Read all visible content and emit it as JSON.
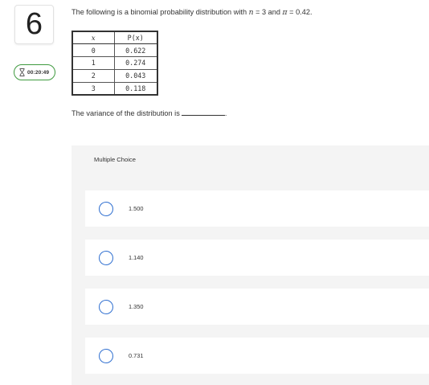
{
  "question_number": "6",
  "timer": {
    "time": "00:20:49"
  },
  "question": {
    "prefix": "The following is a binomial probability distribution with ",
    "n_var": "n",
    "n_eq": " = 3 and ",
    "pi_var": "π",
    "pi_eq": " = 0.42."
  },
  "table": {
    "headers": [
      "x",
      "P(x)"
    ],
    "rows": [
      [
        "0",
        "0.622"
      ],
      [
        "1",
        "0.274"
      ],
      [
        "2",
        "0.043"
      ],
      [
        "3",
        "0.118"
      ]
    ]
  },
  "variance_prompt": "The variance of the distribution is",
  "variance_end": ".",
  "multiple_choice": {
    "label": "Multiple Choice",
    "options": [
      "1.500",
      "1.140",
      "1.350",
      "0.731"
    ]
  },
  "colors": {
    "timer_border": "#3f9a3f",
    "radio_border": "#2f6fd0",
    "panel_bg": "#f4f4f4"
  }
}
